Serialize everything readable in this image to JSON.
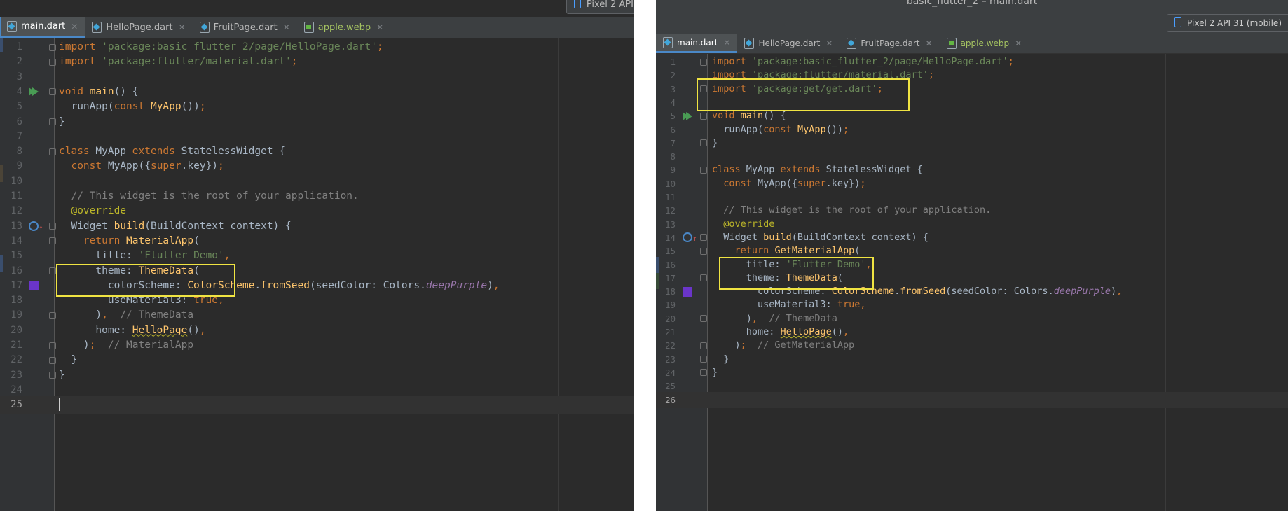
{
  "left": {
    "device_label": "Pixel 2 API",
    "tabs": [
      {
        "label": "main.dart",
        "type": "dart",
        "active": true
      },
      {
        "label": "HelloPage.dart",
        "type": "dart",
        "active": false
      },
      {
        "label": "FruitPage.dart",
        "type": "dart",
        "active": false
      },
      {
        "label": "apple.webp",
        "type": "webp",
        "active": false
      }
    ],
    "current_line": "25",
    "lines": [
      {
        "n": "1",
        "html": "<span class=\"kw\">import</span> <span class=\"str\">'package:basic_flutter_2/page/HelloPage.dart'</span><span class=\"kw\">;</span>"
      },
      {
        "n": "2",
        "html": "<span class=\"kw\">import</span> <span class=\"str\">'package:flutter/material.dart'</span><span class=\"kw\">;</span>"
      },
      {
        "n": "3",
        "html": ""
      },
      {
        "n": "4",
        "html": "<span class=\"kw\">void</span> <span class=\"fn\">main</span>() {"
      },
      {
        "n": "5",
        "html": "  runApp(<span class=\"kw\">const</span> <span class=\"fn\">MyApp</span>())<span class=\"kw\">;</span>"
      },
      {
        "n": "6",
        "html": "}"
      },
      {
        "n": "7",
        "html": ""
      },
      {
        "n": "8",
        "html": "<span class=\"kw\">class</span> MyApp <span class=\"kw\">extends</span> StatelessWidget {"
      },
      {
        "n": "9",
        "html": "  <span class=\"kw\">const</span> MyApp({<span class=\"kw\">super</span>.key})<span class=\"kw\">;</span>"
      },
      {
        "n": "10",
        "html": ""
      },
      {
        "n": "11",
        "html": "  <span class=\"cmt\">// This widget is the root of your application.</span>"
      },
      {
        "n": "12",
        "html": "  <span class=\"ann\">@override</span>"
      },
      {
        "n": "13",
        "html": "  Widget <span class=\"fn\">build</span>(BuildContext context) {"
      },
      {
        "n": "14",
        "html": "    <span class=\"kw\">return</span> <span class=\"fn\">MaterialApp</span>("
      },
      {
        "n": "15",
        "html": "      title: <span class=\"str\">'Flutter Demo'</span><span class=\"kw\">,</span>"
      },
      {
        "n": "16",
        "html": "      theme: <span class=\"fn\">ThemeData</span>("
      },
      {
        "n": "17",
        "html": "        colorScheme: <span class=\"fn\">ColorScheme</span>.<span class=\"fn\">fromSeed</span>(seedColor: Colors.<span class=\"ital\">deepPurple</span>)<span class=\"kw\">,</span>"
      },
      {
        "n": "18",
        "html": "        useMaterial3: <span class=\"kw\">true,</span>"
      },
      {
        "n": "19",
        "html": "      )<span class=\"kw\">,</span>  <span class=\"cmt\">// ThemeData</span>"
      },
      {
        "n": "20",
        "html": "      home: <span class=\"fn squig\">HelloPage</span>()<span class=\"kw\">,</span>"
      },
      {
        "n": "21",
        "html": "    )<span class=\"kw\">;</span>  <span class=\"cmt\">// MaterialApp</span>"
      },
      {
        "n": "22",
        "html": "  }"
      },
      {
        "n": "23",
        "html": "}"
      },
      {
        "n": "24",
        "html": ""
      },
      {
        "n": "25",
        "html": "<span class=\"caret\"></span>"
      }
    ]
  },
  "right": {
    "window_title": "basic_flutter_2 – main.dart",
    "device_label": "Pixel 2 API 31 (mobile)",
    "tabs": [
      {
        "label": "main.dart",
        "type": "dart",
        "active": true
      },
      {
        "label": "HelloPage.dart",
        "type": "dart",
        "active": false
      },
      {
        "label": "FruitPage.dart",
        "type": "dart",
        "active": false
      },
      {
        "label": "apple.webp",
        "type": "webp",
        "active": false
      }
    ],
    "current_line": "26",
    "lines": [
      {
        "n": "1",
        "html": "<span class=\"kw\">import</span> <span class=\"str\">'package:basic_flutter_2/page/HelloPage.dart'</span><span class=\"kw\">;</span>"
      },
      {
        "n": "2",
        "html": "<span class=\"kw\">import</span> <span class=\"str\">'package:flutter/material.dart'</span><span class=\"kw\">;</span>"
      },
      {
        "n": "3",
        "html": "<span class=\"kw\">import</span> <span class=\"str\">'package:get/get.dart'</span><span class=\"kw\">;</span>"
      },
      {
        "n": "4",
        "html": ""
      },
      {
        "n": "5",
        "html": "<span class=\"kw\">void</span> <span class=\"fn\">main</span>() {"
      },
      {
        "n": "6",
        "html": "  runApp(<span class=\"kw\">const</span> <span class=\"fn\">MyApp</span>())<span class=\"kw\">;</span>"
      },
      {
        "n": "7",
        "html": "}"
      },
      {
        "n": "8",
        "html": ""
      },
      {
        "n": "9",
        "html": "<span class=\"kw\">class</span> MyApp <span class=\"kw\">extends</span> StatelessWidget {"
      },
      {
        "n": "10",
        "html": "  <span class=\"kw\">const</span> MyApp({<span class=\"kw\">super</span>.key})<span class=\"kw\">;</span>"
      },
      {
        "n": "11",
        "html": ""
      },
      {
        "n": "12",
        "html": "  <span class=\"cmt\">// This widget is the root of your application.</span>"
      },
      {
        "n": "13",
        "html": "  <span class=\"ann\">@override</span>"
      },
      {
        "n": "14",
        "html": "  Widget <span class=\"fn\">build</span>(BuildContext context) {"
      },
      {
        "n": "15",
        "html": "    <span class=\"kw\">return</span> <span class=\"fn\">GetMaterialApp</span>("
      },
      {
        "n": "16",
        "html": "      title: <span class=\"str\">'Flutter Demo'</span><span class=\"kw\">,</span>"
      },
      {
        "n": "17",
        "html": "      theme: <span class=\"fn\">ThemeData</span>("
      },
      {
        "n": "18",
        "html": "        colorScheme: <span class=\"fn\">ColorScheme</span>.<span class=\"fn\">fromSeed</span>(seedColor: Colors.<span class=\"ital\">deepPurple</span>)<span class=\"kw\">,</span>"
      },
      {
        "n": "19",
        "html": "        useMaterial3: <span class=\"kw\">true,</span>"
      },
      {
        "n": "20",
        "html": "      )<span class=\"kw\">,</span>  <span class=\"cmt\">// ThemeData</span>"
      },
      {
        "n": "21",
        "html": "      home: <span class=\"fn squig\">HelloPage</span>()<span class=\"kw\">,</span>"
      },
      {
        "n": "22",
        "html": "    )<span class=\"kw\">;</span>  <span class=\"cmt\">// GetMaterialApp</span>"
      },
      {
        "n": "23",
        "html": "  }"
      },
      {
        "n": "24",
        "html": "}"
      },
      {
        "n": "25",
        "html": ""
      },
      {
        "n": "26",
        "html": ""
      }
    ]
  },
  "colors": {
    "editor_bg": "#2b2b2b",
    "keyword": "#cc7832",
    "string": "#6a8759",
    "function": "#ffc66d",
    "comment": "#808080",
    "annotation_highlight": "#f0e442",
    "run_icon": "#499c54",
    "deep_purple_swatch": "#6a35c9"
  },
  "icons": {
    "run": "run-triangle-icon",
    "override": "override-up-icon",
    "color": "color-swatch-icon",
    "device": "phone-icon",
    "dart_file": "dart-file-icon",
    "image_file": "image-file-icon"
  }
}
